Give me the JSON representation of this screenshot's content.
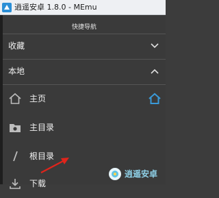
{
  "window": {
    "title": "逍遥安卓 1.8.0 - MEmu"
  },
  "nav": {
    "header": "快捷导航",
    "sections": [
      {
        "label": "收藏",
        "state": "collapsed"
      },
      {
        "label": "本地",
        "state": "expanded"
      }
    ],
    "items": [
      {
        "label": "主页",
        "icon": "home-icon"
      },
      {
        "label": "主目录",
        "icon": "folder-icon"
      },
      {
        "label": "根目录",
        "icon": "slash-icon"
      },
      {
        "label": "下载",
        "icon": "download-icon"
      }
    ]
  },
  "watermark": {
    "text": "逍遥安卓"
  },
  "colors": {
    "accent": "#3a9ad9",
    "annotation": "#e0241b",
    "panel": "#3a3a3a"
  }
}
